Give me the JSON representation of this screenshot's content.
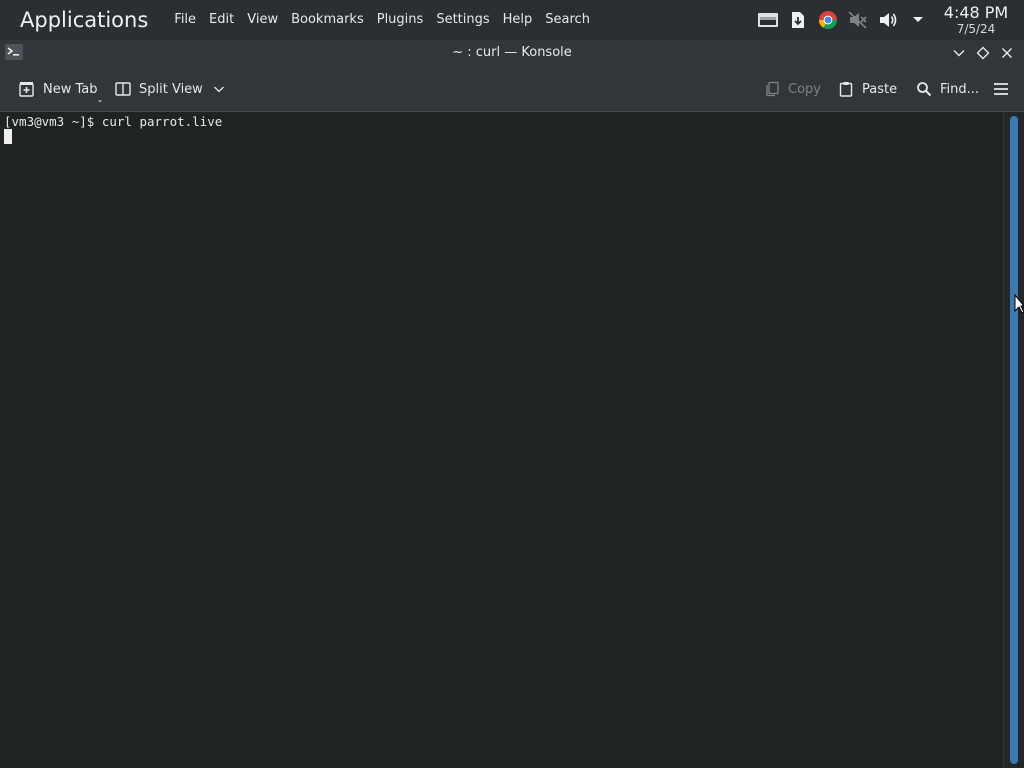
{
  "panel": {
    "launcher_label": "Applications",
    "menu": [
      "File",
      "Edit",
      "View",
      "Bookmarks",
      "Plugins",
      "Settings",
      "Help",
      "Search"
    ],
    "tray_icons": [
      "display-icon",
      "updates-icon",
      "chrome-icon",
      "muted-speaker-icon",
      "volume-icon",
      "tray-expand-icon"
    ],
    "clock_time": "4:48 PM",
    "clock_date": "7/5/24"
  },
  "window": {
    "title": "~ : curl — Konsole",
    "app_icon": "konsole-icon",
    "controls": [
      "minimize-icon",
      "maximize-icon",
      "close-icon"
    ]
  },
  "toolbar": {
    "new_tab_label": "New Tab",
    "split_view_label": "Split View",
    "copy_label": "Copy",
    "paste_label": "Paste",
    "find_label": "Find...",
    "menu_icon": "hamburger-menu-icon"
  },
  "terminal": {
    "lines": [
      "[vm3@vm3 ~]$ curl parrot.live"
    ]
  },
  "colors": {
    "panel_bg": "#2b2e33",
    "window_bg": "#31363b",
    "terminal_bg": "#1f2322",
    "scroll_accent": "#3b7ab0"
  }
}
